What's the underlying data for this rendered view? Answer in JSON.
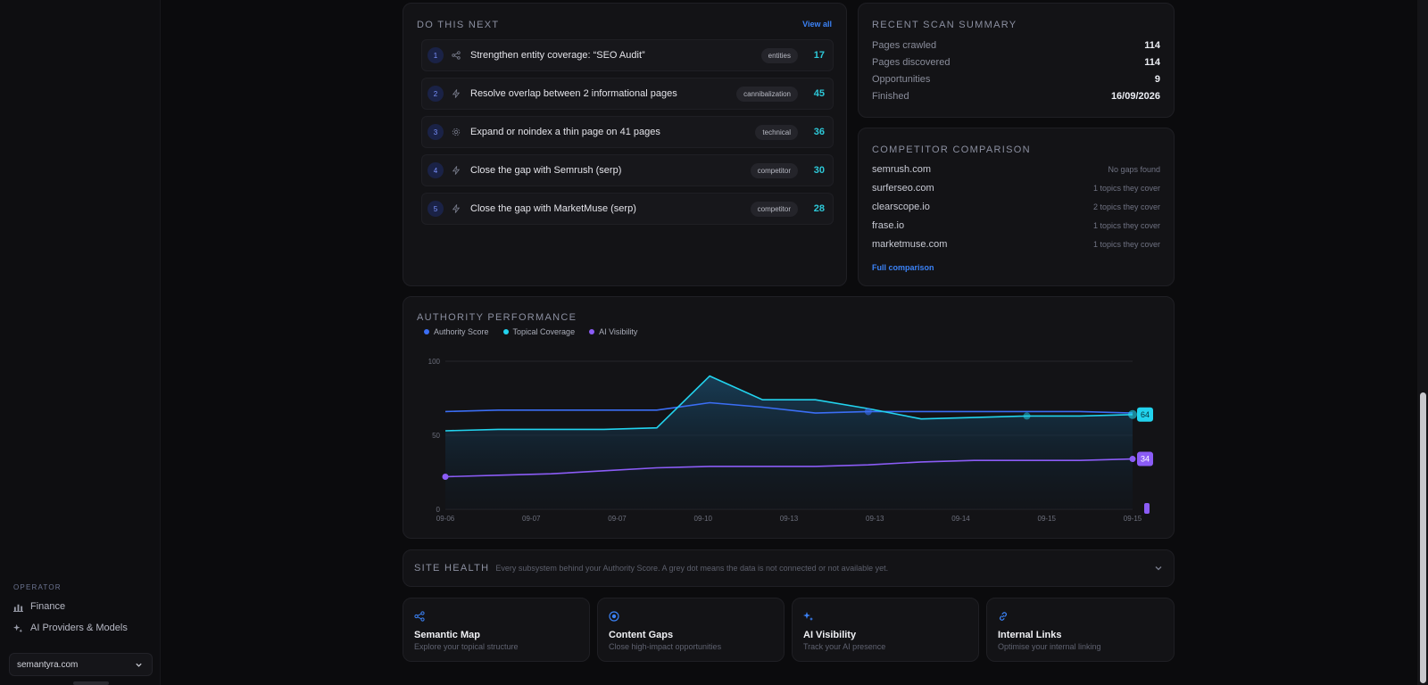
{
  "sidebar": {
    "section_label": "OPERATOR",
    "items": [
      {
        "label": "Finance",
        "icon": "bar-chart-icon"
      },
      {
        "label": "AI Providers & Models",
        "icon": "sparkle-icon"
      }
    ],
    "domain": "semantyra.com"
  },
  "do_next": {
    "title": "DO THIS NEXT",
    "view_all": "View all",
    "tasks": [
      {
        "num": "1",
        "icon": "share-icon",
        "text": "Strengthen entity coverage: “SEO Audit”",
        "tag": "entities",
        "score": "17"
      },
      {
        "num": "2",
        "icon": "bolt-icon",
        "text": "Resolve overlap between 2 informational pages",
        "tag": "cannibalization",
        "score": "45"
      },
      {
        "num": "3",
        "icon": "gear-icon",
        "text": "Expand or noindex a thin page on 41 pages",
        "tag": "technical",
        "score": "36"
      },
      {
        "num": "4",
        "icon": "bolt-icon",
        "text": "Close the gap with Semrush (serp)",
        "tag": "competitor",
        "score": "30"
      },
      {
        "num": "5",
        "icon": "bolt-icon",
        "text": "Close the gap with MarketMuse (serp)",
        "tag": "competitor",
        "score": "28"
      }
    ]
  },
  "scan_summary": {
    "title": "RECENT SCAN SUMMARY",
    "rows": [
      {
        "label": "Pages crawled",
        "value": "114"
      },
      {
        "label": "Pages discovered",
        "value": "114"
      },
      {
        "label": "Opportunities",
        "value": "9"
      },
      {
        "label": "Finished",
        "value": "16/09/2026"
      }
    ]
  },
  "competitors": {
    "title": "COMPETITOR COMPARISON",
    "rows": [
      {
        "domain": "semrush.com",
        "status": "No gaps found"
      },
      {
        "domain": "surferseo.com",
        "status": "1 topics they cover"
      },
      {
        "domain": "clearscope.io",
        "status": "2 topics they cover"
      },
      {
        "domain": "frase.io",
        "status": "1 topics they cover"
      },
      {
        "domain": "marketmuse.com",
        "status": "1 topics they cover"
      }
    ],
    "link": "Full comparison"
  },
  "authority": {
    "title": "AUTHORITY PERFORMANCE",
    "end_labels": {
      "topical": "64",
      "ai": "34"
    }
  },
  "chart_data": {
    "type": "line",
    "title": "AUTHORITY PERFORMANCE",
    "x": [
      "09-06",
      "09-07",
      "09-07",
      "09-10",
      "09-13",
      "09-13",
      "09-14",
      "09-15",
      "09-15"
    ],
    "x_ticks": [
      "09-06",
      "09-07",
      "09-07",
      "09-10",
      "09-13",
      "09-13",
      "09-14",
      "09-15",
      "09-15"
    ],
    "y_ticks": [
      "100",
      "50",
      "0"
    ],
    "ylim": [
      0,
      100
    ],
    "grid": true,
    "legend_position": "top-left",
    "series": [
      {
        "name": "Authority Score",
        "color": "#3b6ef5",
        "values": [
          66,
          67,
          67,
          67,
          67,
          72,
          69,
          65,
          66,
          66,
          66,
          66,
          66,
          65
        ]
      },
      {
        "name": "Topical Coverage",
        "color": "#22d3ee",
        "values": [
          53,
          54,
          54,
          54,
          55,
          90,
          74,
          74,
          68,
          61,
          62,
          63,
          63,
          64
        ]
      },
      {
        "name": "AI Visibility",
        "color": "#8b5cf6",
        "values": [
          22,
          23,
          24,
          26,
          28,
          29,
          29,
          29,
          30,
          32,
          33,
          33,
          33,
          34
        ]
      }
    ]
  },
  "site_health": {
    "title": "SITE HEALTH",
    "subtitle": "Every subsystem behind your Authority Score. A grey dot means the data is not connected or not available yet."
  },
  "nav_cards": [
    {
      "title": "Semantic Map",
      "subtitle": "Explore your topical structure",
      "icon": "share-icon"
    },
    {
      "title": "Content Gaps",
      "subtitle": "Close high-impact opportunities",
      "icon": "target-icon"
    },
    {
      "title": "AI Visibility",
      "subtitle": "Track your AI presence",
      "icon": "sparkle-icon"
    },
    {
      "title": "Internal Links",
      "subtitle": "Optimise your internal linking",
      "icon": "link-icon"
    }
  ],
  "colors": {
    "accent": "#3b82f6",
    "cyan": "#22d3ee",
    "purple": "#8b5cf6",
    "bg": "#0b0b0d",
    "card": "#131316"
  }
}
